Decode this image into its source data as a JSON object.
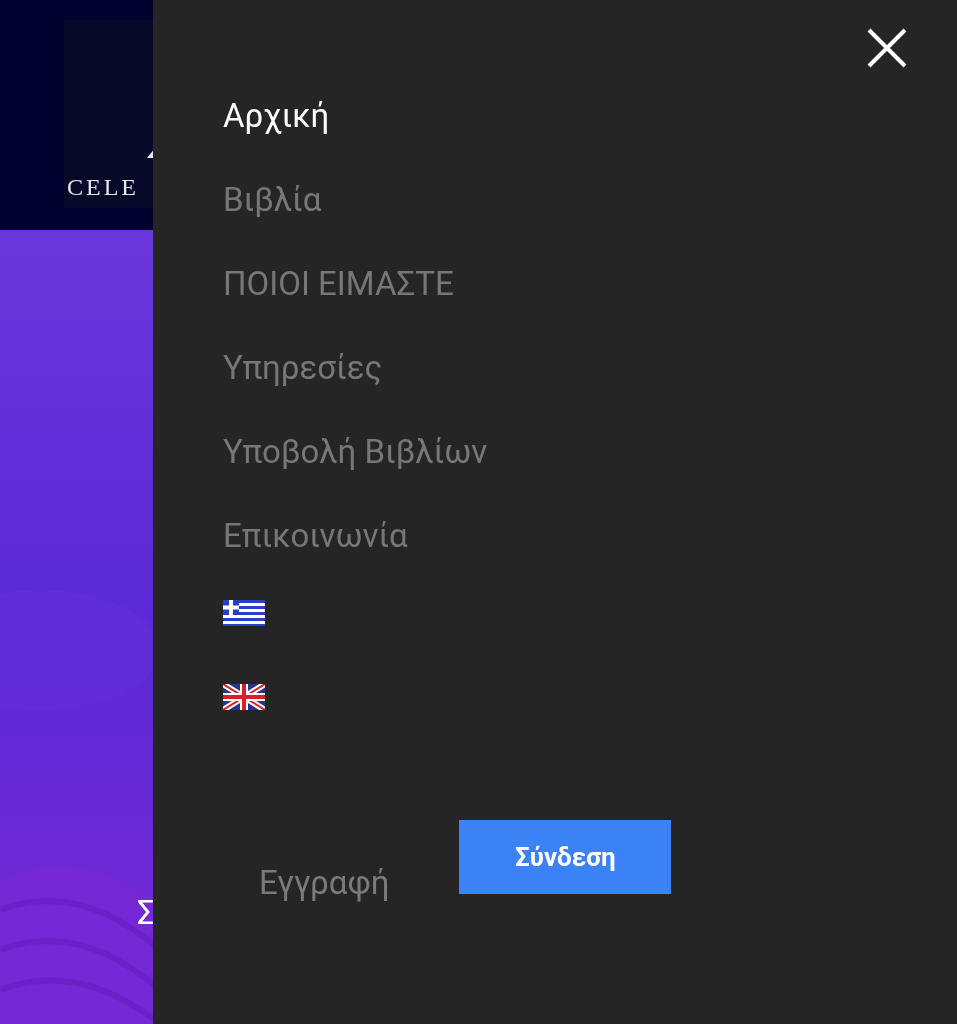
{
  "page_behind": {
    "logo_text": "CELE",
    "hero_texts": [
      "Σ"
    ]
  },
  "menu": {
    "items": [
      {
        "label": "Αρχική",
        "selected": true
      },
      {
        "label": "Βιβλία",
        "selected": false
      },
      {
        "label": "ΠΟΙΟΙ ΕΙΜΑΣΤΕ",
        "selected": false
      },
      {
        "label": "Υπηρεσίες",
        "selected": false
      },
      {
        "label": "Υποβολή Βιβλίων",
        "selected": false
      },
      {
        "label": "Επικοινωνία",
        "selected": false
      }
    ],
    "languages": [
      {
        "kind": "greek"
      },
      {
        "kind": "uk"
      }
    ],
    "register_link": "Εγγραφή",
    "login_button": "Σύνδεση"
  }
}
